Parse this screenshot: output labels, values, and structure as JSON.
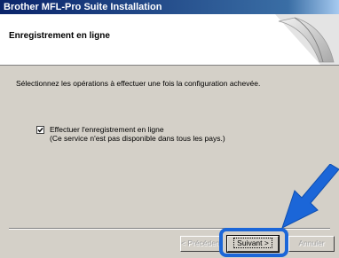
{
  "window": {
    "title": "Brother MFL-Pro Suite Installation"
  },
  "header": {
    "title": "Enregistrement en ligne",
    "graphic_icon": "pen-nib-icon"
  },
  "main": {
    "instruction": "Sélectionnez les opérations à effectuer une fois la configuration achevée.",
    "option": {
      "label": "Effectuer l'enregistrement en ligne",
      "sublabel": "(Ce service n'est pas disponible dans tous les pays.)",
      "checked": true
    }
  },
  "buttons": {
    "prev_label": "< Précédent",
    "next_label": "Suivant >",
    "cancel_label": "Annuler"
  },
  "annotation": {
    "arrow_color": "#1b66d8",
    "highlight_color": "#1b66d8"
  }
}
